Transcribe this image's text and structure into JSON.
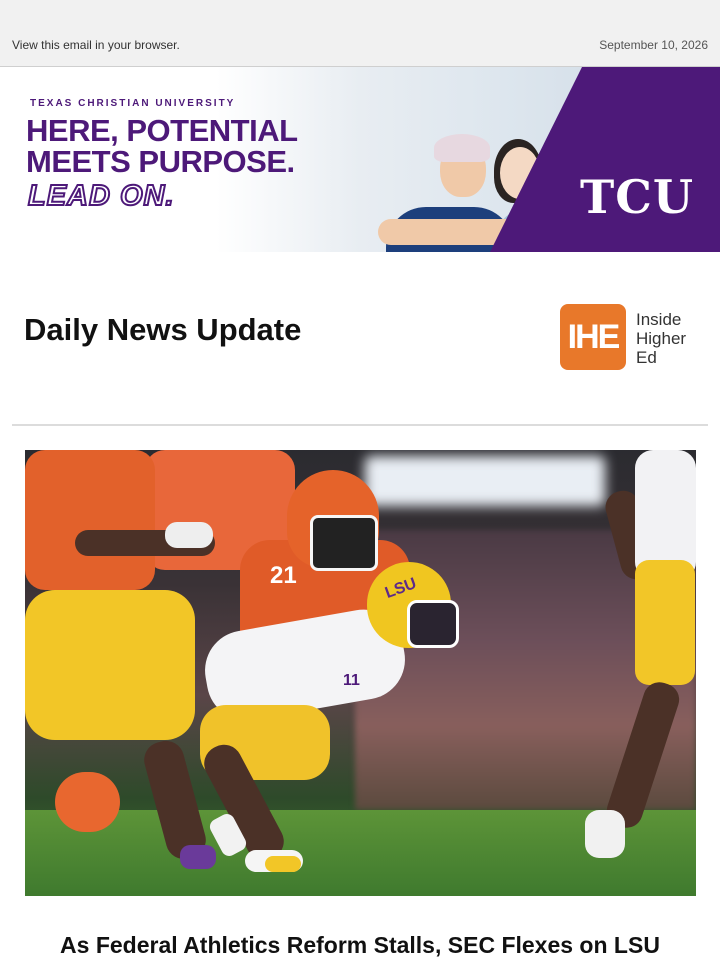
{
  "topbar": {
    "view_in_browser": "View this email in your browser.",
    "date": "September 10, 2026"
  },
  "banner": {
    "university": "TEXAS CHRISTIAN UNIVERSITY",
    "headline_line1": "HERE, POTENTIAL",
    "headline_line2": "MEETS PURPOSE.",
    "tagline": "LEAD ON.",
    "logo_text": "TCU",
    "colors": {
      "purple": "#4d1979"
    }
  },
  "header": {
    "title": "Daily News Update",
    "logo_mark": "IHE",
    "logo_text_line1": "Inside",
    "logo_text_line2": "Higher",
    "logo_text_line3": "Ed",
    "colors": {
      "logo_orange": "#e8782a"
    }
  },
  "photo": {
    "jersey_number_orange": "21",
    "helmet_text": "LSU",
    "jersey_number_white": "11"
  },
  "article": {
    "title": "As Federal Athletics Reform Stalls, SEC Flexes on LSU"
  }
}
